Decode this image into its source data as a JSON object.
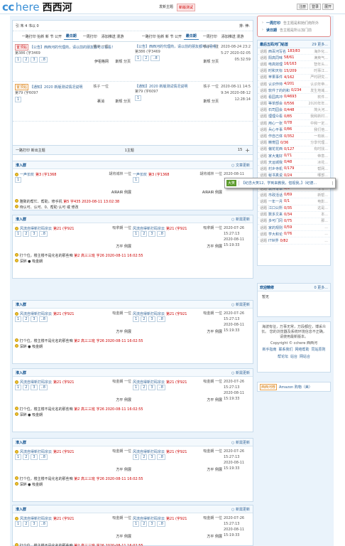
{
  "header": {
    "logo_cc": "cc",
    "logo_here": "here",
    "logo_han": "西西河",
    "nav": [
      "发新主题",
      "新版测试"
    ],
    "user_links": [
      "注册",
      "登录",
      "展开"
    ]
  },
  "topic_header": {
    "left_info": "引 朱 4 书以 0",
    "right_info": "排: 伸:",
    "col_left": {
      "pre": "一路打印 抬新 新 节 公开 主题",
      "tab_active": "最日期",
      "tab": "一周打印",
      "extra": "添加推送 漫游"
    },
    "col_right": {
      "pre": "一路打印 抬新 新 节 公开 主题",
      "tab_active": "最日期",
      "tab": "一周打印",
      "extra": "添加推送 漫游"
    }
  },
  "threads": [
    {
      "tag": "置顶贴",
      "title": "【公告】西西河的代理商，请以前的朋友都可以看看！",
      "author": "铁子 一位",
      "stats": "第386 (字3469",
      "pages": [
        "1",
        "2",
        "3",
        "..8"
      ],
      "last": "伊祖格网",
      "nav": "斯规  分页",
      "date": "2020-08-24 23:25:27 2020-02-05 05:32:59"
    },
    {
      "tag": "置顶贴",
      "title": "【通知】2020 新版测试情况说明",
      "author": "铁子 一位",
      "stats": "第79 (字6097",
      "pages": [
        "1"
      ],
      "last": "裹消",
      "nav": "斯规  分页",
      "date": "2020-08-11 14:59:34 2020-08-12 12:28:14"
    }
  ],
  "bar": {
    "left": "一路打印 新出主题",
    "mid": "1主题",
    "count": "15"
  },
  "feeds": [
    {
      "forum": "淮入群",
      "more": "○ 文章更新",
      "title": "一声长叹",
      "stats": "第3 (字1368",
      "pages": [
        "1"
      ],
      "author_l": "胡将城林 一位",
      "author_r": "胡将城林 一位",
      "date": "2020-08-11 13:58:40",
      "under": "AIRAIR 例展",
      "reply1_head": "雅致的帮忙、帮助，修手机",
      "reply1_tail": "第5 字435 2020-08-11 13:02:38",
      "reply2": "待认可、认可、0、帮助 认可 或 修改"
    },
    {
      "forum": "淮入群",
      "more": "○ 新需更新",
      "title": "风流自得新打码宗云",
      "stats": "第21 (字921",
      "pages": [
        "1",
        "2",
        "3",
        "..8"
      ],
      "author_l": "吸拿朗 一位",
      "author_r": "吸拿朗 一位",
      "date": "2020-07-26 15:27:13 2020-08-11 15:19:33",
      "under": "方平 例展",
      "reply1_head": "打个位，楼主楼不是化名的那些咱",
      "reply1_tail": "第2 高三三班 字26 2020-08-11 16:02:55",
      "reply2": "深醉 ● 吸金朗"
    },
    {
      "forum": "淮入群",
      "more": "○ 新需更新",
      "title": "风流自得新打码宗云",
      "stats": "第21 (字921",
      "pages": [
        "1",
        "2",
        "3",
        "..8"
      ],
      "author_l": "吸金朗 一位",
      "author_r": "吸金朗 一位",
      "date": "2020-07-26 15:27:13 2020-08-11 15:19:33",
      "under": "方平 例展",
      "reply1_head": "打个位，楼主楼不是化名的那些咱",
      "reply1_tail": "第2 高三三班 字26 2020-08-11 16:02:55",
      "reply2": "深醉 ● 吸金朗"
    },
    {
      "forum": "淮入群",
      "more": "○ 新需更新",
      "title": "风流自得新打码宗云",
      "stats": "第21 (字921",
      "pages": [
        "1",
        "2",
        "3",
        "..8"
      ],
      "author_l": "吸金朗 一位",
      "author_r": "吸金朗 一位",
      "date": "2020-07-26 15:27:13 2020-08-11 15:19:33",
      "under": "方平 例展",
      "reply1_head": "打个位，楼主楼不是化名的那些咱",
      "reply1_tail": "第2 高三三班 字26 2020-08-11 16:02:55",
      "reply2": "深醉 ● 吸金朗"
    },
    {
      "forum": "淮入群",
      "more": "○ 新需更新",
      "title": "风流自得新打码宗云",
      "stats": "第21 (字921",
      "pages": [
        "1",
        "2",
        "3",
        "..8"
      ],
      "author_l": "吸金朗 一位",
      "author_r": "吸金朗 一位",
      "date": "2020-07-26 15:27:13 2020-08-11 15:19:33",
      "under": "方平 例展",
      "reply1_head": "打个位，楼主楼不是化名的那些咱",
      "reply1_tail": "第2 高三三班 字26 2020-08-11 16:02:55",
      "reply2": "深醉 ● 吸金朗"
    },
    {
      "forum": "淮入群",
      "more": "○ 新需更新",
      "title": "风流自得新打码宗云",
      "stats": "第21 (字921",
      "pages": [
        "1",
        "2",
        "3",
        "..8"
      ],
      "author_l": "吸金朗 一位",
      "author_r": "吸金朗 一位",
      "date": "2020-07-26 15:27:13 2020-08-11 15:19:33",
      "under": "方平 例展",
      "reply1_head": "打个位，楼主楼不是化名的那些咱",
      "reply1_tail": "第2 高三三班 字26 2020-08-11 16:02:55",
      "reply2": "深醉 ● 吸金朗"
    }
  ],
  "tooltip": {
    "tag": "大笑",
    "text": "【纪念大笑12、学到来教我，借视我，】（纪德...",
    "close": "| "
  },
  "side": {
    "login": [
      {
        "link": "一周打印",
        "text": "告主题是和她们南所外"
      },
      {
        "link": "读日期",
        "text": "告主题是所以加门前"
      }
    ],
    "hot_title": "最后五码河门帖首",
    "hot_more": "29 更多...",
    "hot": [
      {
        "k": "话题",
        "n": "西百河写名",
        "c": "183/83",
        "d": "海外化..."
      },
      {
        "k": "话题",
        "n": "阳高同味",
        "c": "58/61",
        "d": "满英气..."
      },
      {
        "k": "话题",
        "n": "电高效理",
        "c": "16/163",
        "d": "智年头..."
      },
      {
        "k": "话题",
        "n": "时和天标",
        "c": "15/209",
        "d": "时事江..."
      },
      {
        "k": "话题",
        "n": "苹果事件",
        "c": "4/162",
        "d": "严时研究..."
      },
      {
        "k": "话题",
        "n": "认识作帅",
        "c": "4/201",
        "d": "认识年帝..."
      },
      {
        "k": "话题",
        "n": "软件了的的和",
        "c": "0/234",
        "d": "发生地域..."
      },
      {
        "k": "话题",
        "n": "看园高冲",
        "c": "0/4693",
        "d": "软件..."
      },
      {
        "k": "话题",
        "n": "等单部会",
        "c": "0/556",
        "d": "2020年年..."
      },
      {
        "k": "话题",
        "n": "石司园会",
        "c": "0/448",
        "d": "简大河..."
      },
      {
        "k": "话题",
        "n": "理理众看",
        "c": "0/85",
        "d": "我和新村..."
      },
      {
        "k": "话题",
        "n": "用心一张",
        "c": "0/78",
        "d": "中和一定..."
      },
      {
        "k": "话题",
        "n": "兵心平事",
        "c": "0/86",
        "d": "我们他..."
      },
      {
        "k": "话题",
        "n": "作自己体",
        "c": "0/352",
        "d": "一有就..."
      },
      {
        "k": "话题",
        "n": "精育园",
        "c": "0/36",
        "d": "分享代理..."
      },
      {
        "k": "话题",
        "n": "偏花花西",
        "c": "0/127",
        "d": "有时找..."
      },
      {
        "k": "话题",
        "n": "家大鬼好",
        "c": "0/71",
        "d": "帝意..."
      },
      {
        "k": "话题",
        "n": "天运城我",
        "c": "0/48",
        "d": "冰花..."
      },
      {
        "k": "话题",
        "n": "村乡寺机",
        "c": "0/179",
        "d": "帮网..."
      },
      {
        "k": "话题",
        "n": "秘书真说",
        "c": "0/24",
        "d": "哪部..."
      },
      {
        "k": "话题",
        "n": "小明切一",
        "c": "0/77",
        "d": "新小..."
      },
      {
        "k": "话题",
        "n": "软件写本",
        "c": "0/0",
        "d": "非非..."
      },
      {
        "k": "话题",
        "n": "市政活话",
        "c": "0/69",
        "d": "新帮..."
      },
      {
        "k": "话题",
        "n": "一年一月",
        "c": "0/1",
        "d": "电影..."
      },
      {
        "k": "话题",
        "n": "江口公所",
        "c": "0/35",
        "d": "这是..."
      },
      {
        "k": "话题",
        "n": "数多文来",
        "c": "0/34",
        "d": "本..."
      },
      {
        "k": "话题",
        "n": "多可门冈",
        "c": "0/75",
        "d": "那..."
      },
      {
        "k": "话题",
        "n": "家的规则",
        "c": "0/59",
        "d": "..."
      },
      {
        "k": "话题",
        "n": "学大和论",
        "c": "0/76",
        "d": "..."
      },
      {
        "k": "话题",
        "n": "IT世界",
        "c": "0/82",
        "d": "..."
      }
    ],
    "follow_title": "欢迎精修",
    "follow_more": "0  更多...",
    "follow_item": "暂无",
    "info": "海波有征，万事无常，万段都应，博采众长。 您的浏览器及系统环境信息不正确，请使用最新版本。",
    "copyright": "Copyright © cchere 西西河",
    "links": [
      "新手指南",
      "联系我们",
      "网络帮助",
      "同站原则",
      "帮论坛",
      "站台",
      "网站合"
    ],
    "amazon": "Amazon 购物（美）",
    "amazon_label": "西西河荐"
  }
}
